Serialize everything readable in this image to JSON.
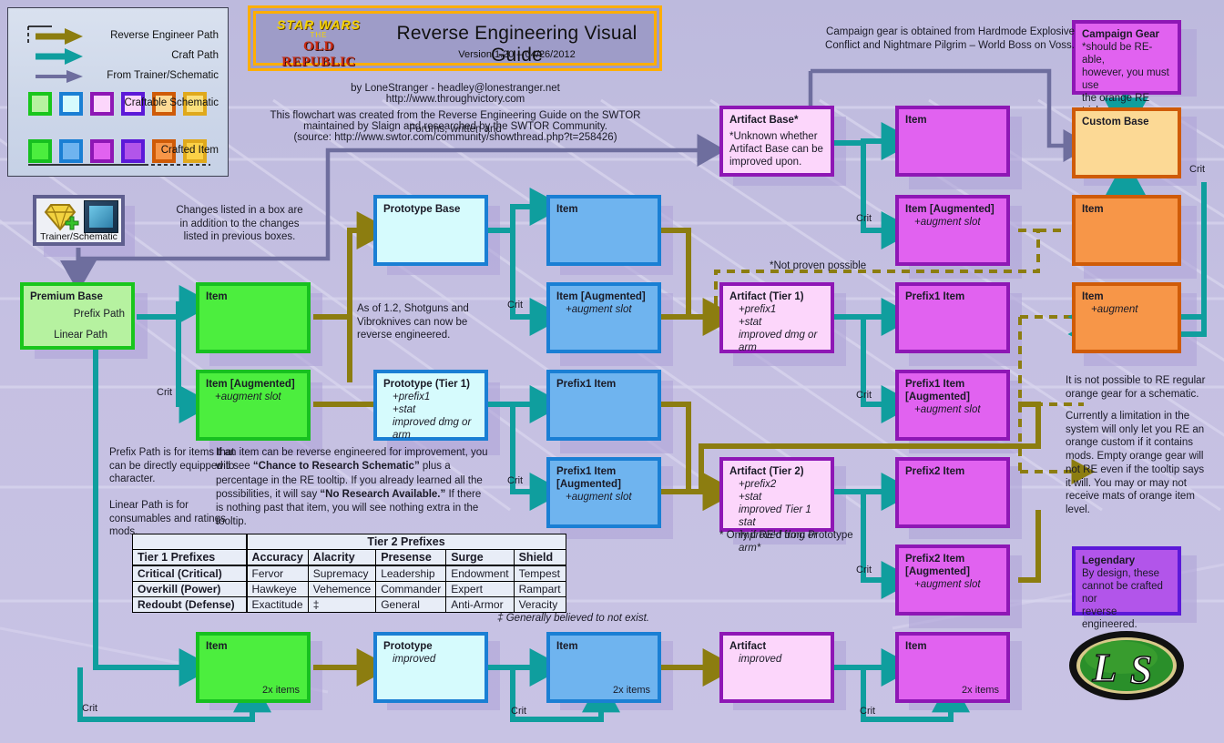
{
  "banner": {
    "title": "Reverse Engineering Visual Guide",
    "version": "Version 1.20 – 04/26/2012",
    "logo_line1": "STAR WARS",
    "logo_line2": "THE",
    "logo_line3": "OLD REPUBLIC"
  },
  "credits": {
    "author": "by LoneStranger - headley@lonestranger.net",
    "site": "http://www.throughvictory.com",
    "source_line1": "This flowchart was created from the Reverse Engineering Guide on the SWTOR Forums, written and",
    "source_line2": "maintained by Slaign and researched by the SWTOR Community.",
    "source_line3": "(source: http://www.swtor.com/community/showthread.php?t=258426)"
  },
  "legend": {
    "reverse_engineer_path": "Reverse Engineer Path",
    "craft_path": "Craft Path",
    "from_trainer": "From Trainer/Schematic",
    "craftable_schematic": "Craftable Schematic",
    "crafted_item": "Crafted Item"
  },
  "trainer": {
    "label": "Trainer/Schematic"
  },
  "notes": {
    "changes_box": "Changes listed in a box are\nin addition to the changes\nlisted in previous boxes.",
    "shotguns": "As of 1.2, Shotguns and\nVibroknives can now be\nreverse engineered.",
    "prefix_path": "Prefix Path is for items that\ncan be directly equipped to\ncharacter.",
    "linear_path": "Linear Path is for\nconsumables and ratings\nmods.",
    "re_tooltip_pre": "If an item can be reverse engineered for improvement, you will see ",
    "re_tooltip_b1": "“Chance to Research Schematic”",
    "re_tooltip_mid": " plus a percentage in the RE tooltip. If you already learned all the possibilities, it will say ",
    "re_tooltip_b2": "“No Research Available.”",
    "re_tooltip_end": " If there is nothing past that item, you will see nothing extra in the tooltip.",
    "not_proven": "*Not proven possible",
    "only_if_re": "* Only if RE'd from Prototype",
    "campaign_info": "Campaign gear is obtained from Hardmode Explosive\nConflict and Nightmare Pilgrim – World Boss on Voss.",
    "orange_note1": "It is not possible to RE regular\norange gear for a schematic.",
    "orange_note2": "Currently a limitation in the\nsystem will only let you RE an\norange custom if it contains\nmods. Empty orange gear will\nnot RE even if the tooltip says\nit will. You may or may not\nreceive mats of orange item\nlevel.",
    "crit": "Crit"
  },
  "nodes": {
    "premium_base": {
      "title": "Premium Base",
      "prefix_path": "Prefix Path",
      "linear_path": "Linear Path"
    },
    "green_item": {
      "title": "Item"
    },
    "green_item_aug": {
      "title": "Item [Augmented]",
      "sub": "+augment slot"
    },
    "prototype_base": {
      "title": "Prototype Base"
    },
    "blue_item": {
      "title": "Item"
    },
    "blue_item_aug": {
      "title": "Item [Augmented]",
      "sub": "+augment slot"
    },
    "prototype_t1": {
      "title": "Prototype (Tier 1)",
      "l1": "+prefix1",
      "l2": "+stat",
      "l3": "improved dmg or arm"
    },
    "prefix1_item": {
      "title": "Prefix1 Item"
    },
    "prefix1_item_aug": {
      "title": "Prefix1 Item",
      "title2": "[Augmented]",
      "sub": "+augment slot"
    },
    "artifact_base": {
      "title": "Artifact Base*",
      "body": "*Unknown whether\nArtifact Base can be\nimproved upon."
    },
    "artifact_t1": {
      "title": "Artifact (Tier 1)",
      "l1": "+prefix1",
      "l2": "+stat",
      "l3": "improved dmg or arm"
    },
    "artifact_t2": {
      "title": "Artifact (Tier 2)",
      "l1": "+prefix2",
      "l2": "+stat",
      "l3": "improved Tier 1 stat",
      "l4": "improved dmg or arm*"
    },
    "purple_item": {
      "title": "Item"
    },
    "purple_item_aug": {
      "title": "Item [Augmented]",
      "sub": "+augment slot"
    },
    "purple_prefix1": {
      "title": "Prefix1 Item"
    },
    "purple_prefix1_aug": {
      "title": "Prefix1 Item",
      "title2": "[Augmented]",
      "sub": "+augment slot"
    },
    "purple_prefix2": {
      "title": "Prefix2 Item"
    },
    "purple_prefix2_aug": {
      "title": "Prefix2 Item",
      "title2": "[Augmented]",
      "sub": "+augment slot"
    },
    "campaign_gear": {
      "title": "Campaign Gear",
      "body": "*should be RE-able,\nhowever, you must use\nthe orange RE trick\nnoted below."
    },
    "custom_base": {
      "title": "Custom Base"
    },
    "orange_item": {
      "title": "Item"
    },
    "orange_item_aug": {
      "title": "Item",
      "sub": "+augment"
    },
    "legendary": {
      "title": "Legendary",
      "body": "By design, these\ncannot be crafted nor\nreverse engineered."
    },
    "linear_green": {
      "title": "Item",
      "foot": "2x items"
    },
    "linear_blue_proto": {
      "title": "Prototype",
      "sub": "improved"
    },
    "linear_blue": {
      "title": "Item",
      "foot": "2x items"
    },
    "linear_artifact": {
      "title": "Artifact",
      "sub": "improved"
    },
    "linear_purple": {
      "title": "Item",
      "foot": "2x items"
    }
  },
  "table": {
    "corner": "",
    "tier1_header": "Tier 1 Prefixes",
    "tier2_header": "Tier 2 Prefixes",
    "columns": [
      "Accuracy",
      "Alacrity",
      "Presense",
      "Surge",
      "Shield"
    ],
    "rows": [
      {
        "label": "Critical (Critical)",
        "cells": [
          "Fervor",
          "Supremacy",
          "Leadership",
          "Endowment",
          "Tempest"
        ]
      },
      {
        "label": "Overkill (Power)",
        "cells": [
          "Hawkeye",
          "Vehemence",
          "Commander",
          "Expert",
          "Rampart"
        ]
      },
      {
        "label": "Redoubt (Defense)",
        "cells": [
          "Exactitude",
          "‡",
          "General",
          "Anti-Armor",
          "Veracity"
        ]
      }
    ],
    "footnote": "‡ Generally believed to not exist."
  },
  "colors": {
    "background": "#c4bfe0",
    "re_path": "#8c7d10",
    "craft_path": "#0f9e9e",
    "trainer_path": "#6e6e9e",
    "green_border": "#19c61c",
    "blue_border": "#1a7fd4",
    "purple_border": "#8e17b5",
    "orange_border": "#cf5b08",
    "gold_border": "#e0a91c",
    "banner_gold": "#ffae00"
  }
}
